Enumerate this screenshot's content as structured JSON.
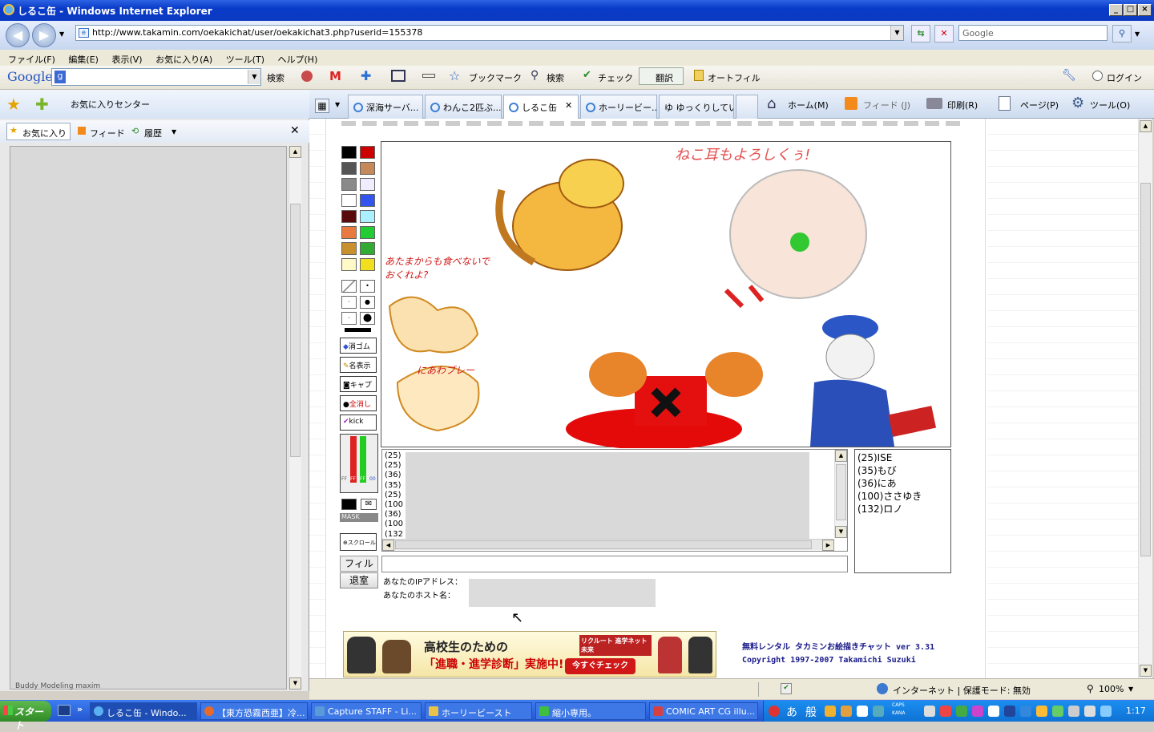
{
  "window": {
    "title": "しるこ缶 - Windows Internet Explorer"
  },
  "address": {
    "url": "http://www.takamin.com/oekakichat/user/oekakichat3.php?userid=155378"
  },
  "search": {
    "placeholder": "Google"
  },
  "menu": [
    "ファイル(F)",
    "編集(E)",
    "表示(V)",
    "お気に入り(A)",
    "ツール(T)",
    "ヘルプ(H)"
  ],
  "google_toolbar": {
    "logo": "Google",
    "search_label": "検索",
    "bookmark_label": "ブックマーク",
    "search2_label": "検索",
    "check_label": "チェック",
    "translate_label": "翻訳",
    "autofill_label": "オートフィル",
    "login_label": "ログイン"
  },
  "favbar": {
    "center_label": "お気に入りセンター"
  },
  "tabs": [
    {
      "label": "深海サーバ..."
    },
    {
      "label": "わんこ2匹ぶ..."
    },
    {
      "label": "しるこ缶"
    },
    {
      "label": "ホーリービー..."
    },
    {
      "label": "ゆ ゆっくりしてい..."
    }
  ],
  "commandbar": {
    "home": "ホーム(M)",
    "feeds": "フィード (J)",
    "print": "印刷(R)",
    "page": "ページ(P)",
    "tools": "ツール(O)"
  },
  "favpanel": {
    "favorites": "お気に入り",
    "feeds": "フィード",
    "history": "履歴",
    "bottom_item": "Buddy Modeling maxim"
  },
  "chat": {
    "tools": [
      "消ゴム",
      "名表示",
      "キャプ",
      "全消し",
      "kick"
    ],
    "mask_label": "MASK",
    "scroll_label": "スクロール",
    "rgb_values": [
      "FF",
      "FF",
      "FF",
      "00"
    ],
    "log_lines": [
      "(25)",
      "(25)",
      "(36)",
      "(35)",
      "(25)",
      "(100",
      "(36)",
      "(100",
      "(132"
    ],
    "users": [
      "(25)ISE",
      "(35)もび",
      "(36)にあ",
      "(100)ささゆき",
      "(132)ロノ"
    ],
    "filter_label": "フィルタ",
    "exit_label": "退室",
    "ip_label": "あなたのIPアドレス：",
    "host_label": "あなたのホスト名：",
    "palette": [
      "#000000",
      "#cc0000",
      "#555555",
      "#c68a5a",
      "#8a8a8a",
      "#eeeeff",
      "#ffffff",
      "#3355ee",
      "#5a0a0a",
      "#aaf0ff",
      "#e87a40",
      "#22cc33",
      "#c8902e",
      "#33aa33",
      "#fff8c8",
      "#f2e020"
    ]
  },
  "canvas": {
    "text1": "ねこ耳もよろしくぅ!",
    "text2": "あたまからも食べないで おくれよ?",
    "text3": "にあわブレー"
  },
  "banner": {
    "headline": "高校生のための",
    "headline2": "「進職・進学診断」実施中!",
    "cta": "今すぐチェック",
    "brand": "リクルート 進学ネット 未来"
  },
  "credits": {
    "line1": "無料レンタル タカミンお絵描きチャット ver 3.31",
    "line2": "Copyright 1997-2007 Takamichi Suzuki"
  },
  "status": {
    "zone": "インターネット | 保護モード: 無効",
    "zoom": "100%"
  },
  "taskbar": {
    "start": "スタート",
    "tasks": [
      "しるこ缶 - Windo...",
      "【東方恐霧西亜】冷...",
      "Capture STAFF - Li...",
      "ホーリービースト",
      "縮小専用。",
      "COMIC ART CG illu..."
    ],
    "ime": [
      "あ",
      "般"
    ],
    "clock": "1:17",
    "caps": "CAPS",
    "kana": "KANA"
  }
}
